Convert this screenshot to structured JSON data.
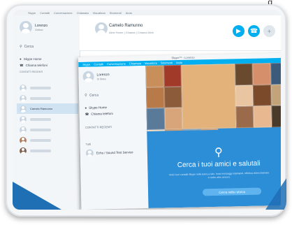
{
  "caption": "g",
  "back_window": {
    "menu": [
      "Skype",
      "Contatti",
      "Conversazione",
      "Chiamata",
      "Visualizza",
      "Strumenti",
      "Aiuto"
    ],
    "profile_name": "Lorenzo",
    "profile_status": "Online",
    "search_label": "Cerca",
    "nav": [
      "Skype Home",
      "Chiama telefoni"
    ],
    "credit": "CONTATTI  RECENTI",
    "contact_selected": "Camelo Ramunno",
    "header_name": "Camelo Ramunno",
    "header_sub": "Aleix Home | Chiama | Chiama Web"
  },
  "front_window": {
    "title": "Skype™ - Lorenzo",
    "menu": [
      "Skype",
      "Contatti",
      "Conversazione",
      "Chiamata",
      "Visualizza",
      "Strumenti",
      "Aiuto"
    ],
    "profile_name": "Lorenzo",
    "profile_status": "In linea",
    "search_label": "Cerca",
    "nav": [
      "Skype Home",
      "Chiama telefoni"
    ],
    "contacts_label": "CONTATTI  RECENTI",
    "tutti_label": "Tutti",
    "contact": "Echo / Sound Test Service",
    "main_title": "Cerca i tuoi amici e salutali",
    "main_desc": "Vedi i tuoi contatti Skype nella barra a lato. Invia messaggi istantanei, effettua videochiamate e molto altro ancora.",
    "main_button": "Cerca nella rubrica"
  },
  "colors": {
    "skype_blue": "#00aff0",
    "main_blue": "#2d8ed8",
    "strip_blue": "#1f6fb5"
  },
  "collage_colors": [
    "#c98f5a",
    "#a23a2a",
    "#e2b27a",
    "#6a4a2e",
    "#d58f6b",
    "#3c5a7a",
    "#b97a4a",
    "#8c5b3a",
    "#e9c5a2",
    "#7b4a2a",
    "#c2a37a",
    "#5a7a9a",
    "#d8a57a",
    "#9a6a4a",
    "#e8b890",
    "#4a3a2a",
    "#f0d2b0",
    "#b8804a",
    "#6b8aa8",
    "#c28a5a"
  ]
}
